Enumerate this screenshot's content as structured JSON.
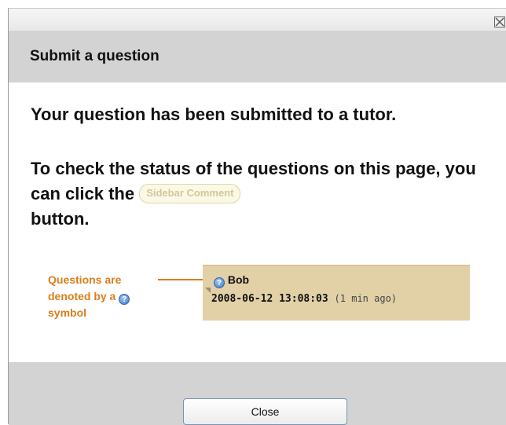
{
  "dialog": {
    "title": "Submit a question",
    "message": "Your question has been submitted to a tutor.",
    "instruction_before": "To check the status of the questions on this page, you can click the",
    "sidebar_button_label": "Sidebar Comment",
    "instruction_after": "button.",
    "annotation": {
      "line1": "Questions are",
      "line2": "denoted by a",
      "line3": "symbol",
      "icon": "question-mark-icon"
    },
    "comment": {
      "author": "Bob",
      "timestamp": "2008-06-12 13:08:03",
      "relative_time": "(1 min ago)"
    },
    "close_button_label": "Close",
    "close_icon": "close-icon"
  },
  "colors": {
    "title_bar": "#d3d3d3",
    "annotation": "#d97e1c",
    "comment_background": "#e2d0a6",
    "sidebar_button_text": "#d0c89a"
  }
}
